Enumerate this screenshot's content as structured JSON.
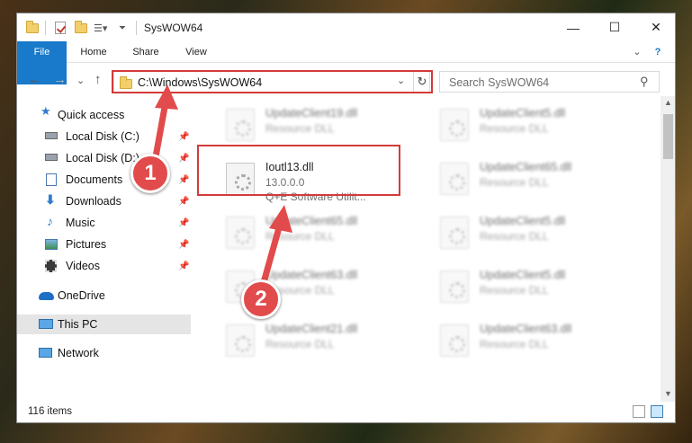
{
  "window": {
    "title": "SysWOW64",
    "minimize": "—",
    "maximize": "☐",
    "close": "✕"
  },
  "ribbon": {
    "tabs": [
      {
        "label": "File"
      },
      {
        "label": "Home"
      },
      {
        "label": "Share"
      },
      {
        "label": "View"
      }
    ],
    "expand": "⌄",
    "help": "?"
  },
  "nav_buttons": {
    "back": "←",
    "forward": "→",
    "recent": "⌄",
    "up": "↑"
  },
  "address": {
    "path": "C:\\Windows\\SysWOW64",
    "dropdown": "⌄",
    "refresh": "↻"
  },
  "search": {
    "placeholder": "Search SysWOW64",
    "icon": "search-icon"
  },
  "sidebar": {
    "items": [
      {
        "label": "Quick access",
        "icon": "star-icon",
        "pinned": false
      },
      {
        "label": "Local Disk (C:)",
        "icon": "drive-icon",
        "pinned": true
      },
      {
        "label": "Local Disk (D:)",
        "icon": "drive-icon",
        "pinned": true
      },
      {
        "label": "Documents",
        "icon": "documents-icon",
        "pinned": true
      },
      {
        "label": "Downloads",
        "icon": "download-icon",
        "pinned": true
      },
      {
        "label": "Music",
        "icon": "music-icon",
        "pinned": true
      },
      {
        "label": "Pictures",
        "icon": "pictures-icon",
        "pinned": true
      },
      {
        "label": "Videos",
        "icon": "videos-icon",
        "pinned": true
      },
      {
        "label": "OneDrive",
        "icon": "cloud-icon",
        "pinned": false
      },
      {
        "label": "This PC",
        "icon": "computer-icon",
        "pinned": false
      },
      {
        "label": "Network",
        "icon": "network-icon",
        "pinned": false
      }
    ],
    "pin_glyph": "📌"
  },
  "files": [
    {
      "name": "UpdateClient19.dll",
      "type": "Resource DLL"
    },
    {
      "name": "UpdateClient5.dll",
      "type": "Resource DLL"
    },
    {
      "name": "Ioutl13.dll",
      "version": "13.0.0.0",
      "company": "Q+E Software Utilit..."
    },
    {
      "name": "UpdateClient65.dll",
      "type": "Resource DLL"
    },
    {
      "name": "UpdateClient65.dll",
      "type": "Resource DLL"
    },
    {
      "name": "UpdateClient5.dll",
      "type": "Resource DLL"
    },
    {
      "name": "UpdateClient63.dll",
      "type": "Resource DLL"
    },
    {
      "name": "UpdateClient5.dll",
      "type": "Resource DLL"
    },
    {
      "name": "UpdateClient21.dll",
      "type": "Resource DLL"
    },
    {
      "name": "UpdateClient63.dll",
      "type": "Resource DLL"
    }
  ],
  "status": {
    "count": "116 items"
  },
  "annotations": {
    "step1": "1",
    "step2": "2",
    "color": "#e24b4b"
  }
}
